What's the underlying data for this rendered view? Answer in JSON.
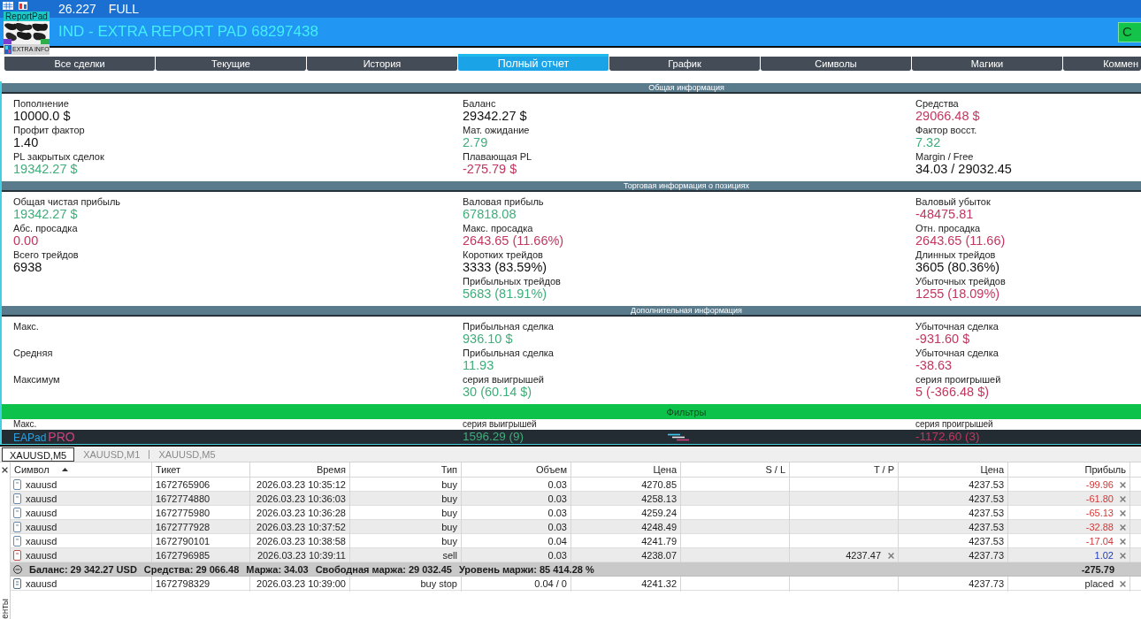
{
  "toolbar": {
    "version": "26.227",
    "mode": "FULL"
  },
  "logo": {
    "title": "ReportPad",
    "caption": "EXTRA INFO"
  },
  "header": {
    "title": "IND - EXTRA REPORT PAD 68297438",
    "button": "С"
  },
  "tabs": [
    {
      "label": "Все сделки",
      "selected": false
    },
    {
      "label": "Текущие",
      "selected": false
    },
    {
      "label": "История",
      "selected": false
    },
    {
      "label": "Полный отчет",
      "selected": true
    },
    {
      "label": "График",
      "selected": false
    },
    {
      "label": "Символы",
      "selected": false
    },
    {
      "label": "Магики",
      "selected": false
    },
    {
      "label": "Коммен",
      "selected": false
    }
  ],
  "sections": [
    {
      "title": "Общая информация",
      "columns": [
        {
          "items": [
            {
              "label": "Пополнение",
              "value": "10000.0 $",
              "color": "#111111"
            },
            {
              "label": "Профит фактор",
              "value": "1.40",
              "color": "#111111"
            },
            {
              "label": "PL закрытых сделок",
              "value": "19342.27 $",
              "color": "#3fae7a"
            }
          ]
        },
        {
          "items": [
            {
              "label": "Баланс",
              "value": "29342.27 $",
              "color": "#111111"
            },
            {
              "label": "Мат. ожидание",
              "value": "2.79",
              "color": "#3fae7a"
            },
            {
              "label": "Плавающая PL",
              "value": "-275.79 $",
              "color": "#c2375f"
            }
          ]
        },
        {
          "items": [
            {
              "label": "Средства",
              "value": "29066.48 $",
              "color": "#c2375f"
            },
            {
              "label": "Фактор восст.",
              "value": "7.32",
              "color": "#3fae7a"
            },
            {
              "label": "Margin / Free",
              "value": "34.03 / 29032.45",
              "color": "#111111"
            }
          ]
        }
      ]
    },
    {
      "title": "Торговая информация о позициях",
      "columns": [
        {
          "items": [
            {
              "label": "Общая чистая прибыль",
              "value": "19342.27 $",
              "color": "#3fae7a"
            },
            {
              "label": "Абс. просадка",
              "value": "0.00",
              "color": "#c2375f"
            },
            {
              "label": "Всего трейдов",
              "value": "6938",
              "color": "#111111"
            }
          ]
        },
        {
          "items": [
            {
              "label": "Валовая прибыль",
              "value": "67818.08",
              "color": "#3fae7a"
            },
            {
              "label": "Макс. просадка",
              "value": "2643.65 (11.66%)",
              "color": "#c2375f"
            },
            {
              "label": "Коротких трейдов",
              "value": "3333 (83.59%)",
              "color": "#111111"
            },
            {
              "label": "Прибыльных трейдов",
              "value": "5683 (81.91%)",
              "color": "#3fae7a"
            }
          ]
        },
        {
          "items": [
            {
              "label": "Валовый убыток",
              "value": "-48475.81",
              "color": "#c2375f"
            },
            {
              "label": "Отн. просадка",
              "value": "2643.65 (11.66)",
              "color": "#c2375f"
            },
            {
              "label": "Длинных трейдов",
              "value": "3605 (80.36%)",
              "color": "#111111"
            },
            {
              "label": "Убыточных трейдов",
              "value": "1255 (18.09%)",
              "color": "#c2375f"
            }
          ]
        }
      ]
    },
    {
      "title": "Дополнительная информация",
      "columns": [
        {
          "items": [
            {
              "label": "Макс."
            },
            {
              "label": "Средняя"
            },
            {
              "label": "Максимум"
            }
          ]
        },
        {
          "items": [
            {
              "label": "Прибыльная сделка",
              "value": "936.10 $",
              "color": "#3fae7a"
            },
            {
              "label": "Прибыльная сделка",
              "value": "11.93",
              "color": "#3fae7a"
            },
            {
              "label": "серия выигрышей",
              "value": "30 (60.14 $)",
              "color": "#3fae7a"
            }
          ]
        },
        {
          "items": [
            {
              "label": "Убыточная сделка",
              "value": "-931.60 $",
              "color": "#c2375f"
            },
            {
              "label": "Убыточная сделка",
              "value": "-38.63",
              "color": "#c2375f"
            },
            {
              "label": "серия проигрышей",
              "value": "5 (-366.48 $)",
              "color": "#c2375f"
            }
          ]
        }
      ]
    }
  ],
  "filter_bar": {
    "label": "Фильтры"
  },
  "covered_row": {
    "items": [
      {
        "label": "Макс."
      },
      {
        "label": "серия выигрышей",
        "value": "1596.29 (9)",
        "color": "#3fae7a"
      },
      {
        "label": "серия проигрышей",
        "value": "-1172.60 (3)",
        "color": "#c2375f"
      }
    ]
  },
  "brand": {
    "name": "EAPad",
    "edition": "PRO"
  },
  "chart_tabs": [
    {
      "label": "XAUUSD,M5",
      "selected": true
    },
    {
      "label": "XAUUSD,M1",
      "selected": false
    },
    {
      "label": "XAUUSD,M5",
      "selected": false
    }
  ],
  "side_panel": {
    "label": "енты"
  },
  "table": {
    "columns": [
      {
        "label": "Символ",
        "sorted": true
      },
      {
        "label": "Тикет",
        "sorted": false
      },
      {
        "label": "Время",
        "sorted": false
      },
      {
        "label": "Тип",
        "sorted": false
      },
      {
        "label": "Объем",
        "sorted": false
      },
      {
        "label": "Цена",
        "sorted": false
      },
      {
        "label": "S / L",
        "sorted": false
      },
      {
        "label": "T / P",
        "sorted": false
      },
      {
        "label": "Цена",
        "sorted": false
      },
      {
        "label": "Прибыль",
        "sorted": false
      }
    ],
    "rows": [
      {
        "kind": "buy",
        "symbol": "xauusd",
        "ticket": "1672765906",
        "time": "2026.03.23 10:35:12",
        "type": "buy",
        "volume": "0.03",
        "price": "4270.85",
        "current_price": "4237.53",
        "profit": "-99.96",
        "color": "#d03a3a"
      },
      {
        "kind": "buy",
        "symbol": "xauusd",
        "ticket": "1672774880",
        "time": "2026.03.23 10:36:03",
        "type": "buy",
        "volume": "0.03",
        "price": "4258.13",
        "current_price": "4237.53",
        "profit": "-61.80",
        "color": "#d03a3a"
      },
      {
        "kind": "buy",
        "symbol": "xauusd",
        "ticket": "1672775980",
        "time": "2026.03.23 10:36:28",
        "type": "buy",
        "volume": "0.03",
        "price": "4259.24",
        "current_price": "4237.53",
        "profit": "-65.13",
        "color": "#d03a3a"
      },
      {
        "kind": "buy",
        "symbol": "xauusd",
        "ticket": "1672777928",
        "time": "2026.03.23 10:37:52",
        "type": "buy",
        "volume": "0.03",
        "price": "4248.49",
        "current_price": "4237.53",
        "profit": "-32.88",
        "color": "#d03a3a"
      },
      {
        "kind": "buy",
        "symbol": "xauusd",
        "ticket": "1672790101",
        "time": "2026.03.23 10:38:58",
        "type": "buy",
        "volume": "0.04",
        "price": "4241.79",
        "current_price": "4237.53",
        "profit": "-17.04",
        "color": "#d03a3a"
      },
      {
        "kind": "sell",
        "symbol": "xauusd",
        "ticket": "1672796985",
        "time": "2026.03.23 10:39:11",
        "type": "sell",
        "volume": "0.03",
        "price": "4238.07",
        "tp": "4237.47",
        "current_price": "4237.73",
        "profit": "1.02",
        "color": "#2038c0"
      },
      {
        "kind": "summary",
        "expanded": true,
        "fields": [
          "Баланс: 29 342.27 USD",
          "Средства: 29 066.48",
          "Маржа: 34.03",
          "Свободная маржа: 29 032.45",
          "Уровень маржи: 85 414.28 %"
        ],
        "profit": "-275.79"
      },
      {
        "kind": "order",
        "symbol": "xauusd",
        "ticket": "1672798329",
        "time": "2026.03.23 10:39:00",
        "type": "buy stop",
        "volume": "0.04 / 0",
        "price": "4241.32",
        "current_price": "4237.73",
        "profit": "placed"
      }
    ]
  }
}
